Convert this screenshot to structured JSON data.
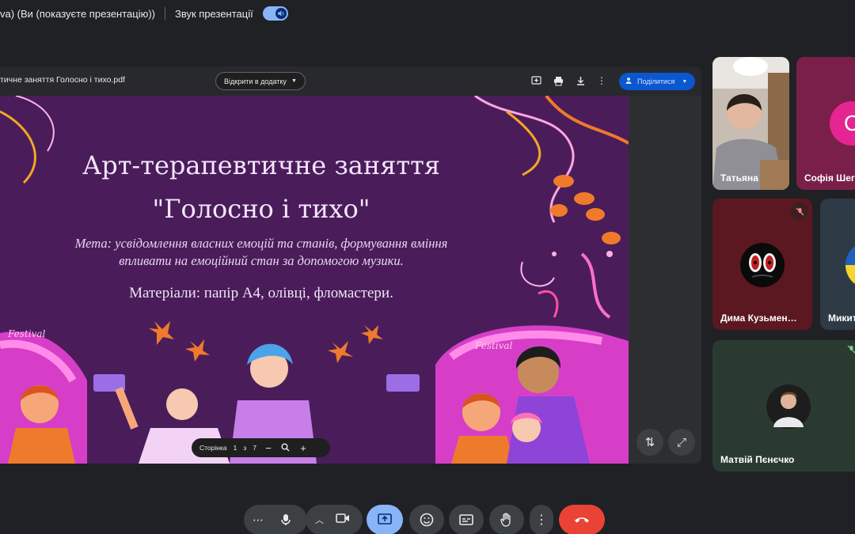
{
  "topbar": {
    "presenter_text": "va) (Ви (показуєте презентацію))",
    "sound_label": "Звук презентації"
  },
  "pdf": {
    "filename": "тичне заняття Голосно і тихо.pdf",
    "open_with": "Відкрити в додатку",
    "share_label": "Поділитися"
  },
  "slide": {
    "title_line1": "Арт-терапевтичне заняття",
    "title_line2": "\"Голосно і тихо\"",
    "goal_line1": "Мета: усвідомлення власних емоцій та станів, формування вміння",
    "goal_line2": "впливати на емоційний стан за допомогою музики.",
    "materials": "Матеріали: папір А4, олівці, фломастери.",
    "festival_left": "Festival",
    "festival_right": "Festival"
  },
  "pager": {
    "label": "Сторінка",
    "current": "1",
    "of": "з",
    "total": "7"
  },
  "participants": [
    {
      "name": "Татьяна"
    },
    {
      "name": "Софія Шег",
      "initial": "С"
    },
    {
      "name": "Дима Кузьмен…"
    },
    {
      "name": "Микит"
    },
    {
      "name": "Матвій Пєнєчко"
    }
  ],
  "colors": {
    "accent": "#8ab4f8",
    "share_blue": "#0b57d0",
    "end_call_red": "#ea4335",
    "present_active": "#8ab4f8",
    "slide_bg": "#4a1d5a"
  },
  "icons": {
    "more": "more-horiz-icon",
    "mic": "mic-icon",
    "camera": "videocam-icon",
    "present": "present-to-all-icon",
    "emoji": "emoji-icon",
    "captions": "captions-icon",
    "hand": "raise-hand-icon",
    "options": "more-vert-icon",
    "end_call": "call-end-icon"
  }
}
